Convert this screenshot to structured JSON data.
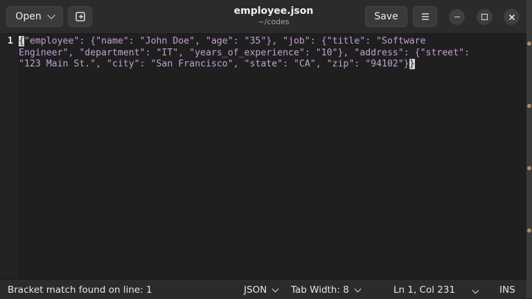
{
  "header": {
    "open_label": "Open",
    "save_label": "Save",
    "title": "employee.json",
    "subtitle": "~/codes"
  },
  "icons": {
    "new_tab": "new-tab-icon",
    "menu": "hamburger-menu-icon",
    "minimize": "minimize-icon",
    "maximize": "maximize-icon",
    "close": "close-icon",
    "dropdown": "chevron-down-icon"
  },
  "editor": {
    "line_number": "1",
    "code_lines": [
      "\"employee\": {\"name\": \"John Doe\", \"age\": \"35\"}, \"job\": {\"title\": \"Software",
      "Engineer\", \"department\": \"IT\", \"years_of_experience\": \"10\"}, \"address\": {\"street\":",
      "\"123 Main St.\", \"city\": \"San Francisco\", \"state\": \"CA\", \"zip\": \"94102\"}"
    ],
    "open_bracket": "{",
    "close_bracket": "}",
    "text_color": "#c4a0d8"
  },
  "statusbar": {
    "message": "Bracket match found on line: 1",
    "language": "JSON",
    "tab_width": "Tab Width: 8",
    "position": "Ln 1, Col 231",
    "mode": "INS"
  }
}
